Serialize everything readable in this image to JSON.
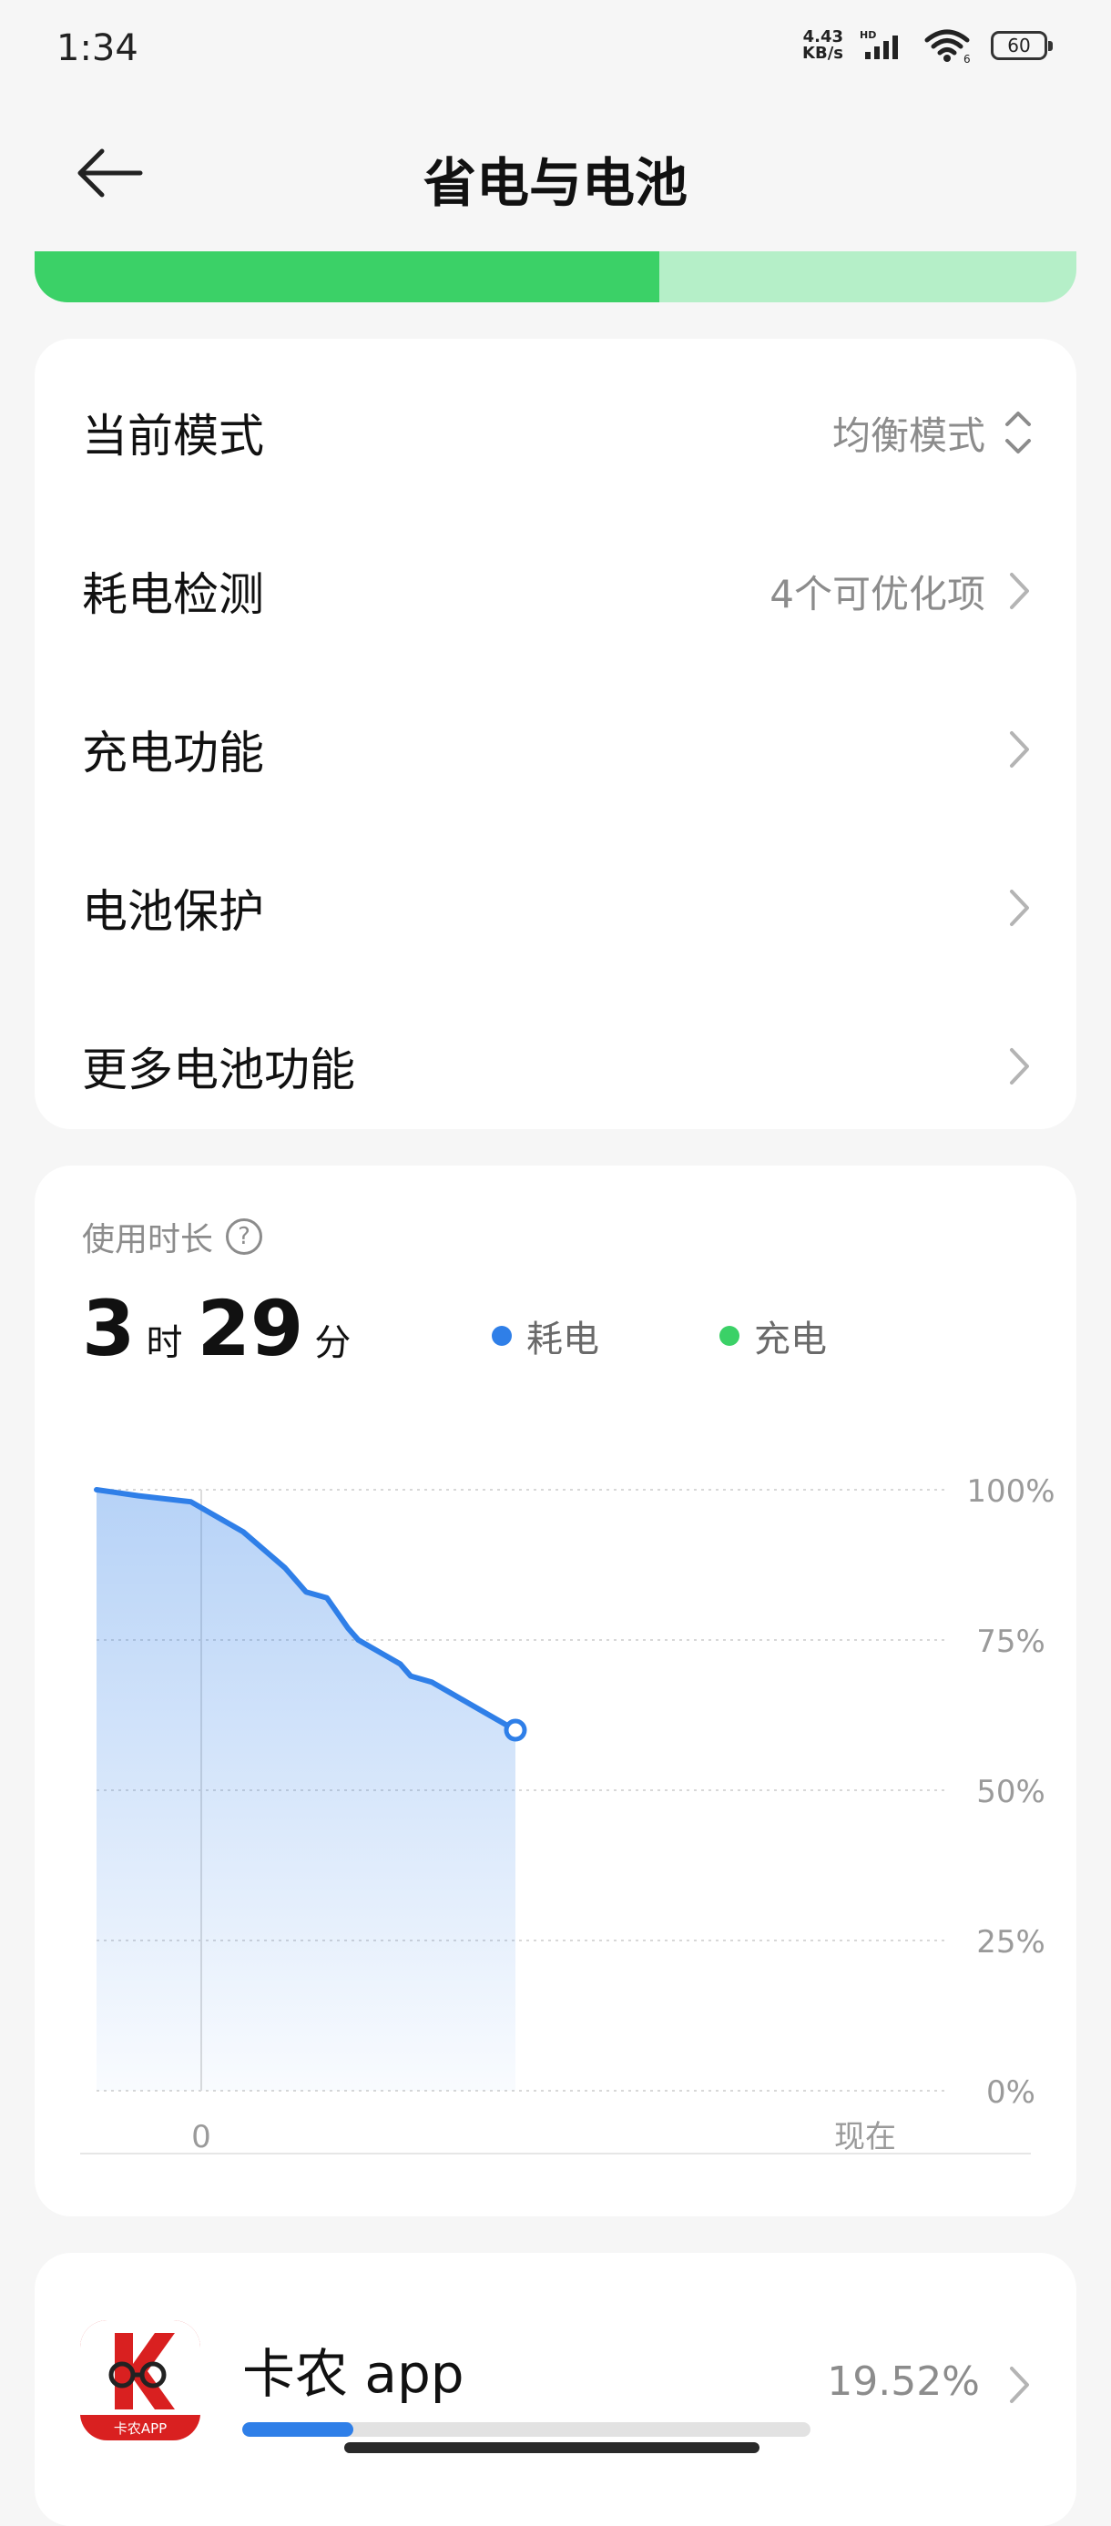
{
  "status_bar": {
    "time": "1:34",
    "net_speed_value": "4.43",
    "net_speed_unit": "KB/s",
    "network_label": "HD",
    "wifi_label": "6",
    "battery_level": "60"
  },
  "header": {
    "title": "省电与电池"
  },
  "battery_bar": {
    "level_fraction": 0.6,
    "fill_color": "#3bd167",
    "track_color": "#b5efc8"
  },
  "settings": {
    "items": [
      {
        "label": "当前模式",
        "value": "均衡模式"
      },
      {
        "label": "耗电检测",
        "value": "4个可优化项"
      },
      {
        "label": "充电功能",
        "value": ""
      },
      {
        "label": "电池保护",
        "value": ""
      },
      {
        "label": "更多电池功能",
        "value": ""
      }
    ]
  },
  "usage": {
    "title": "使用时长",
    "hours": "3",
    "hours_unit": "时",
    "minutes": "29",
    "minutes_unit": "分",
    "legend": [
      {
        "label": "耗电",
        "color": "#2f7fe8"
      },
      {
        "label": "充电",
        "color": "#3bd167"
      }
    ]
  },
  "chart_data": {
    "type": "area",
    "series": [
      {
        "name": "耗电",
        "color": "#2f7fe8",
        "x": [
          -1.0,
          -0.6,
          -0.1,
          0.0,
          0.2,
          0.4,
          0.6,
          0.8,
          0.9,
          1.0,
          1.2,
          1.4,
          1.5,
          1.7,
          1.9,
          2.0,
          2.2,
          2.4,
          2.6,
          3.0
        ],
        "y": [
          100,
          99,
          98,
          97,
          95,
          93,
          90,
          87,
          85,
          83,
          82,
          77,
          75,
          73,
          71,
          69,
          68,
          66,
          64,
          60
        ]
      }
    ],
    "x_tick_labels": [
      "0",
      "现在"
    ],
    "y_tick_labels": [
      "100%",
      "75%",
      "50%",
      "25%",
      "0%"
    ],
    "ylim": [
      0,
      100
    ],
    "grid": true,
    "legend_placement": "top"
  },
  "app_list": [
    {
      "name": "卡农 app",
      "percent": "19.52%",
      "fraction": 0.1952,
      "icon_text": "卡农APP"
    }
  ]
}
